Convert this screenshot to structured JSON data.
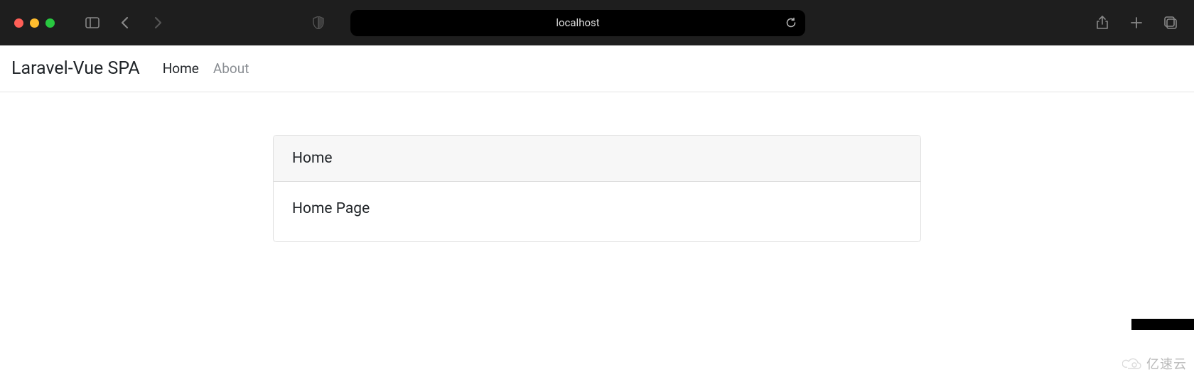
{
  "browser": {
    "address": "localhost"
  },
  "navbar": {
    "brand": "Laravel-Vue SPA",
    "links": [
      {
        "label": "Home",
        "active": true
      },
      {
        "label": "About",
        "active": false
      }
    ]
  },
  "card": {
    "header": "Home",
    "body": "Home Page"
  },
  "watermark": {
    "text": "亿速云"
  }
}
